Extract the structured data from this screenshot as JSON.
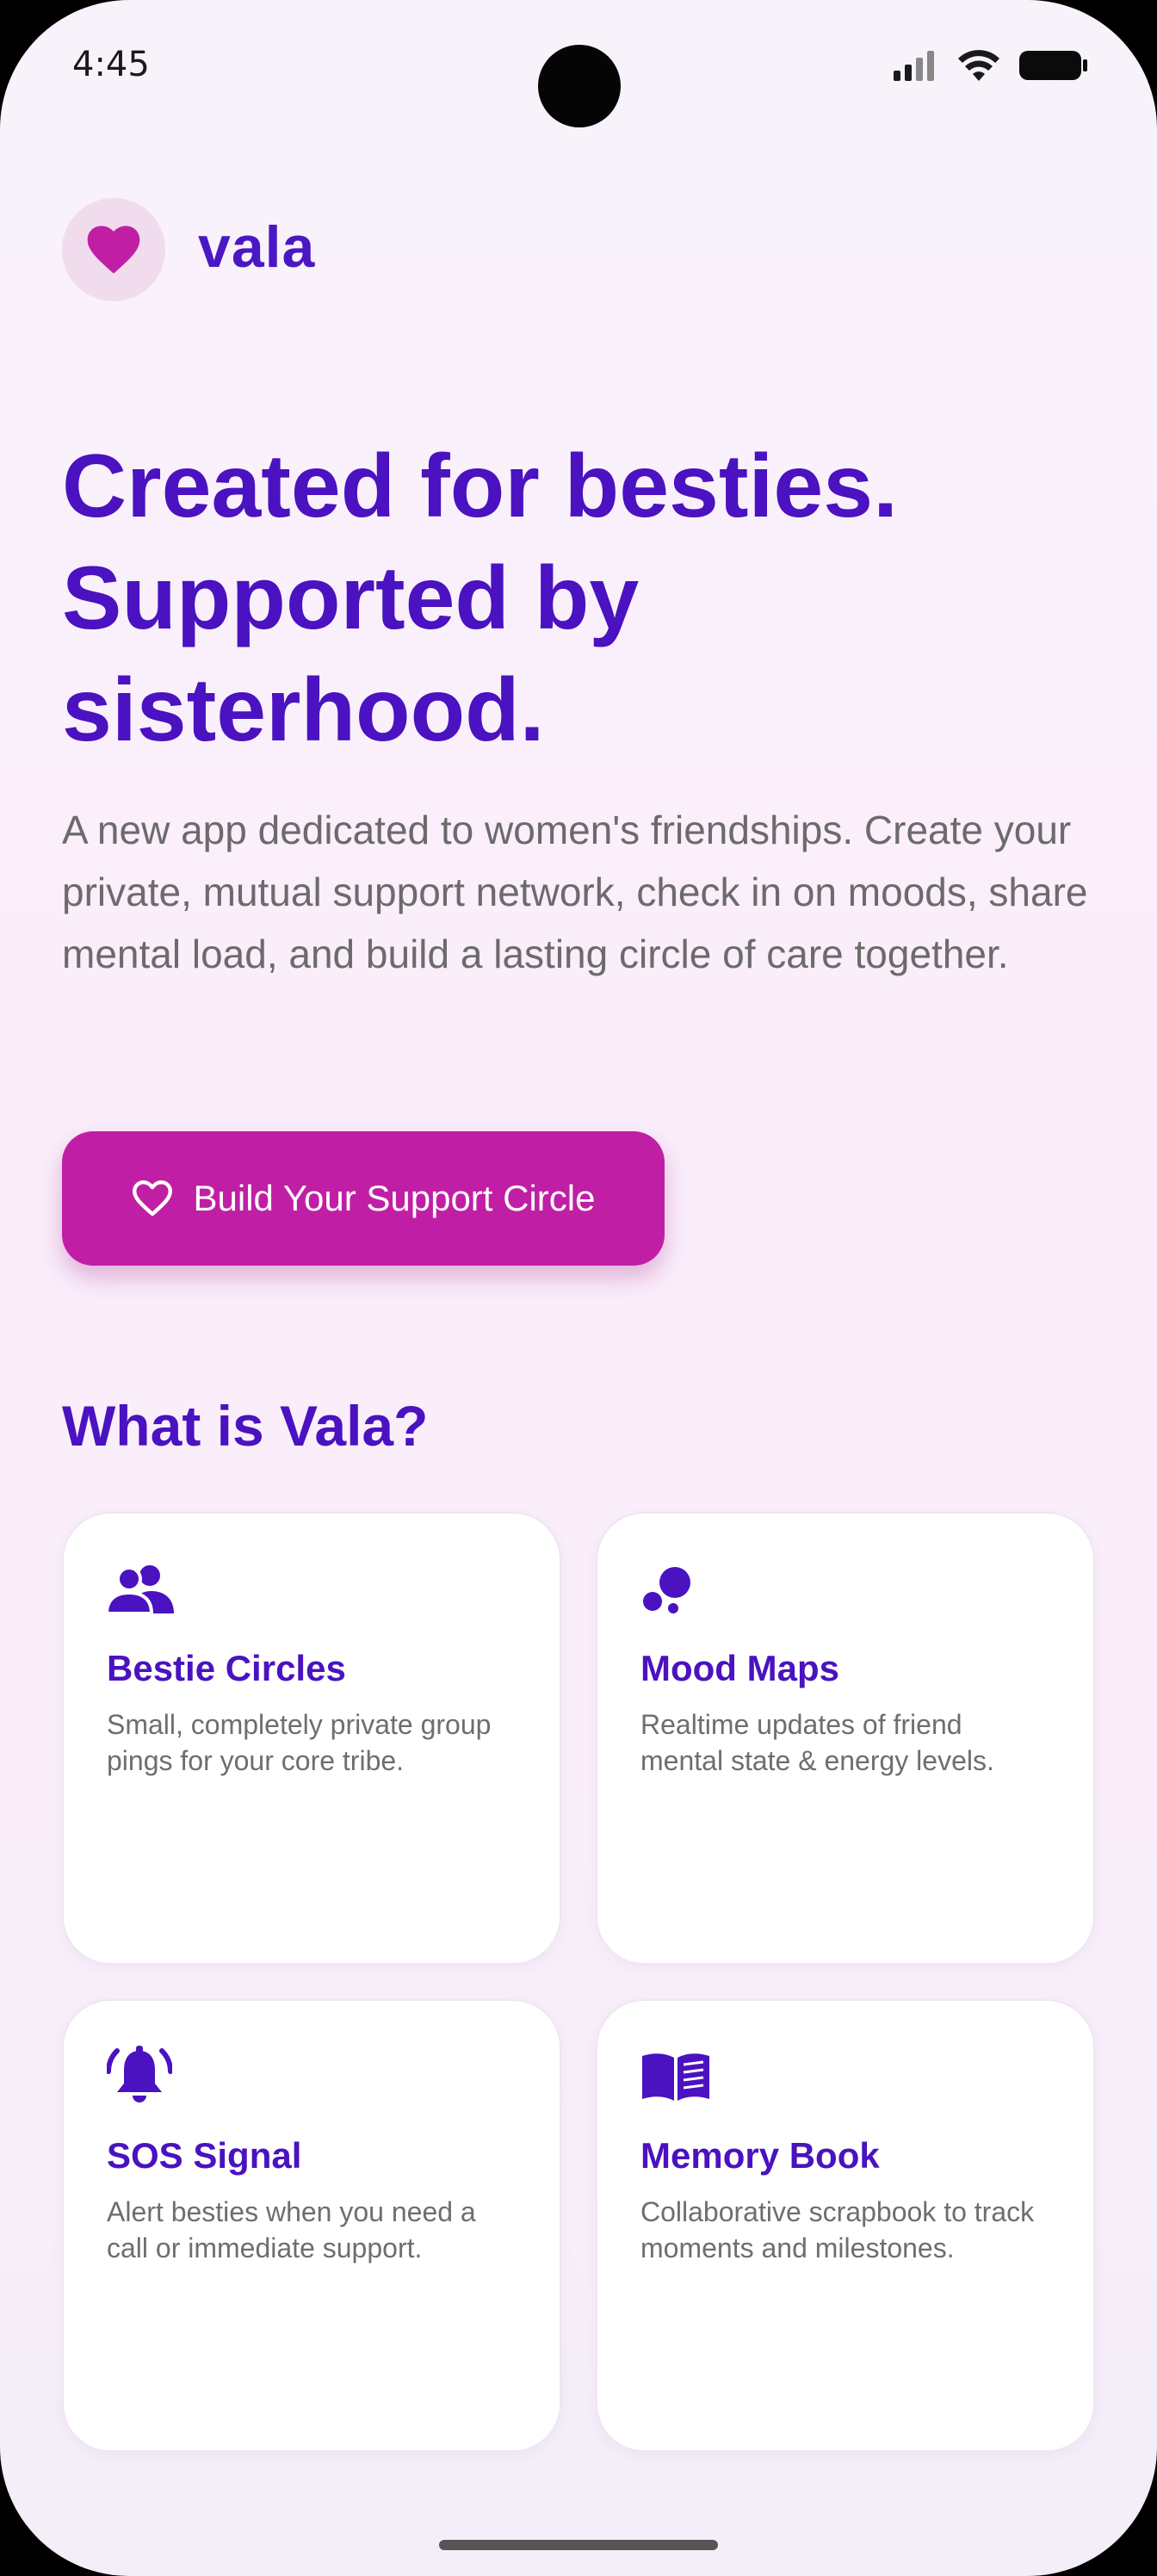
{
  "status_bar": {
    "time": "4:45"
  },
  "header": {
    "brand": "vala"
  },
  "hero": {
    "title_lines": [
      "Created for besties.",
      "Supported by",
      "sisterhood."
    ],
    "subtitle": "A new app dedicated to women's friendships. Create your private, mutual support network, check in on moods, share mental load, and build a lasting circle of care together."
  },
  "cta": {
    "label": "Build Your Support Circle"
  },
  "section": {
    "title": "What is Vala?"
  },
  "features": [
    {
      "title": "Bestie Circles",
      "description": "Small, completely private group pings for your core tribe.",
      "icon": "group-icon"
    },
    {
      "title": "Mood Maps",
      "description": "Realtime updates of friend mental state & energy levels.",
      "icon": "bubbles-icon"
    },
    {
      "title": "SOS Signal",
      "description": "Alert besties when you need a call or immediate support.",
      "icon": "bell-icon"
    },
    {
      "title": "Memory Book",
      "description": "Collaborative scrapbook to track moments and milestones.",
      "icon": "book-icon"
    }
  ],
  "colors": {
    "primary": "#4a12c0",
    "accent": "#c01fa5",
    "muted_text": "#6b6b6b",
    "logo_bg": "#f1dcee"
  }
}
